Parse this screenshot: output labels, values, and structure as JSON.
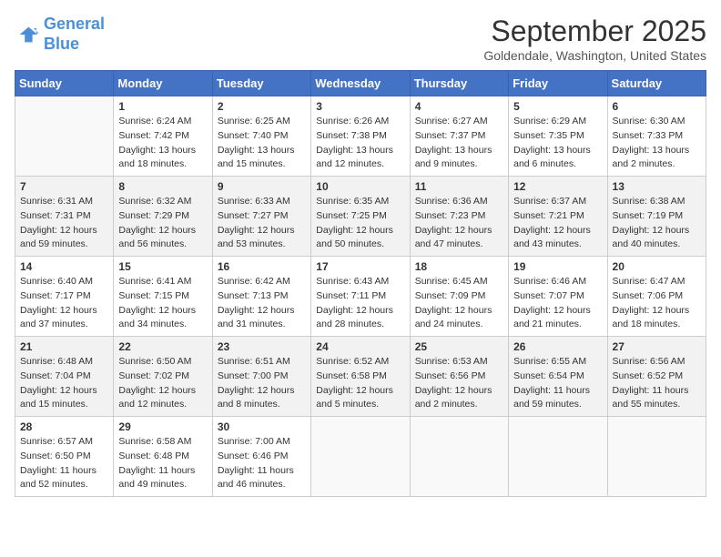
{
  "logo": {
    "line1": "General",
    "line2": "Blue"
  },
  "title": "September 2025",
  "location": "Goldendale, Washington, United States",
  "days_of_week": [
    "Sunday",
    "Monday",
    "Tuesday",
    "Wednesday",
    "Thursday",
    "Friday",
    "Saturday"
  ],
  "weeks": [
    [
      {
        "day": "",
        "info": ""
      },
      {
        "day": "1",
        "info": "Sunrise: 6:24 AM\nSunset: 7:42 PM\nDaylight: 13 hours\nand 18 minutes."
      },
      {
        "day": "2",
        "info": "Sunrise: 6:25 AM\nSunset: 7:40 PM\nDaylight: 13 hours\nand 15 minutes."
      },
      {
        "day": "3",
        "info": "Sunrise: 6:26 AM\nSunset: 7:38 PM\nDaylight: 13 hours\nand 12 minutes."
      },
      {
        "day": "4",
        "info": "Sunrise: 6:27 AM\nSunset: 7:37 PM\nDaylight: 13 hours\nand 9 minutes."
      },
      {
        "day": "5",
        "info": "Sunrise: 6:29 AM\nSunset: 7:35 PM\nDaylight: 13 hours\nand 6 minutes."
      },
      {
        "day": "6",
        "info": "Sunrise: 6:30 AM\nSunset: 7:33 PM\nDaylight: 13 hours\nand 2 minutes."
      }
    ],
    [
      {
        "day": "7",
        "info": "Sunrise: 6:31 AM\nSunset: 7:31 PM\nDaylight: 12 hours\nand 59 minutes."
      },
      {
        "day": "8",
        "info": "Sunrise: 6:32 AM\nSunset: 7:29 PM\nDaylight: 12 hours\nand 56 minutes."
      },
      {
        "day": "9",
        "info": "Sunrise: 6:33 AM\nSunset: 7:27 PM\nDaylight: 12 hours\nand 53 minutes."
      },
      {
        "day": "10",
        "info": "Sunrise: 6:35 AM\nSunset: 7:25 PM\nDaylight: 12 hours\nand 50 minutes."
      },
      {
        "day": "11",
        "info": "Sunrise: 6:36 AM\nSunset: 7:23 PM\nDaylight: 12 hours\nand 47 minutes."
      },
      {
        "day": "12",
        "info": "Sunrise: 6:37 AM\nSunset: 7:21 PM\nDaylight: 12 hours\nand 43 minutes."
      },
      {
        "day": "13",
        "info": "Sunrise: 6:38 AM\nSunset: 7:19 PM\nDaylight: 12 hours\nand 40 minutes."
      }
    ],
    [
      {
        "day": "14",
        "info": "Sunrise: 6:40 AM\nSunset: 7:17 PM\nDaylight: 12 hours\nand 37 minutes."
      },
      {
        "day": "15",
        "info": "Sunrise: 6:41 AM\nSunset: 7:15 PM\nDaylight: 12 hours\nand 34 minutes."
      },
      {
        "day": "16",
        "info": "Sunrise: 6:42 AM\nSunset: 7:13 PM\nDaylight: 12 hours\nand 31 minutes."
      },
      {
        "day": "17",
        "info": "Sunrise: 6:43 AM\nSunset: 7:11 PM\nDaylight: 12 hours\nand 28 minutes."
      },
      {
        "day": "18",
        "info": "Sunrise: 6:45 AM\nSunset: 7:09 PM\nDaylight: 12 hours\nand 24 minutes."
      },
      {
        "day": "19",
        "info": "Sunrise: 6:46 AM\nSunset: 7:07 PM\nDaylight: 12 hours\nand 21 minutes."
      },
      {
        "day": "20",
        "info": "Sunrise: 6:47 AM\nSunset: 7:06 PM\nDaylight: 12 hours\nand 18 minutes."
      }
    ],
    [
      {
        "day": "21",
        "info": "Sunrise: 6:48 AM\nSunset: 7:04 PM\nDaylight: 12 hours\nand 15 minutes."
      },
      {
        "day": "22",
        "info": "Sunrise: 6:50 AM\nSunset: 7:02 PM\nDaylight: 12 hours\nand 12 minutes."
      },
      {
        "day": "23",
        "info": "Sunrise: 6:51 AM\nSunset: 7:00 PM\nDaylight: 12 hours\nand 8 minutes."
      },
      {
        "day": "24",
        "info": "Sunrise: 6:52 AM\nSunset: 6:58 PM\nDaylight: 12 hours\nand 5 minutes."
      },
      {
        "day": "25",
        "info": "Sunrise: 6:53 AM\nSunset: 6:56 PM\nDaylight: 12 hours\nand 2 minutes."
      },
      {
        "day": "26",
        "info": "Sunrise: 6:55 AM\nSunset: 6:54 PM\nDaylight: 11 hours\nand 59 minutes."
      },
      {
        "day": "27",
        "info": "Sunrise: 6:56 AM\nSunset: 6:52 PM\nDaylight: 11 hours\nand 55 minutes."
      }
    ],
    [
      {
        "day": "28",
        "info": "Sunrise: 6:57 AM\nSunset: 6:50 PM\nDaylight: 11 hours\nand 52 minutes."
      },
      {
        "day": "29",
        "info": "Sunrise: 6:58 AM\nSunset: 6:48 PM\nDaylight: 11 hours\nand 49 minutes."
      },
      {
        "day": "30",
        "info": "Sunrise: 7:00 AM\nSunset: 6:46 PM\nDaylight: 11 hours\nand 46 minutes."
      },
      {
        "day": "",
        "info": ""
      },
      {
        "day": "",
        "info": ""
      },
      {
        "day": "",
        "info": ""
      },
      {
        "day": "",
        "info": ""
      }
    ]
  ]
}
